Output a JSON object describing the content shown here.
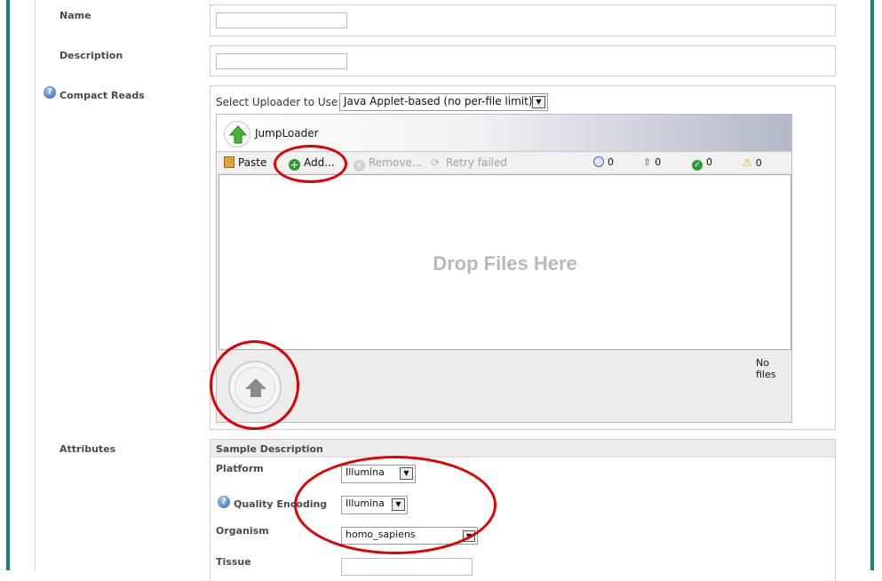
{
  "form": {
    "name_label": "Name",
    "description_label": "Description",
    "compact_reads_label": "Compact Reads",
    "attributes_label": "Attributes"
  },
  "uploader": {
    "select_label": "Select Uploader to Use:",
    "select_value": "Java Applet-based (no per-file limit)",
    "app_name": "JumpLoader",
    "paste_label": "Paste",
    "add_label": "Add...",
    "remove_label": "Remove...",
    "retry_label": "Retry failed",
    "counters": [
      "0",
      "0",
      "0",
      "0"
    ],
    "drop_text": "Drop Files Here",
    "status_text": "No files"
  },
  "sample": {
    "section_title": "Sample Description",
    "platform_label": "Platform",
    "platform_value": "Illumina",
    "quality_label": "Quality Encoding",
    "quality_value": "Illumina",
    "organism_label": "Organism",
    "organism_value": "homo_sapiens",
    "tissue_label": "Tissue"
  },
  "icons": {
    "help": "?",
    "dropdown_arrow": "▼"
  },
  "colors": {
    "frame": "#1a7f74",
    "highlight": "#e00000",
    "help": "#2a64b8"
  }
}
